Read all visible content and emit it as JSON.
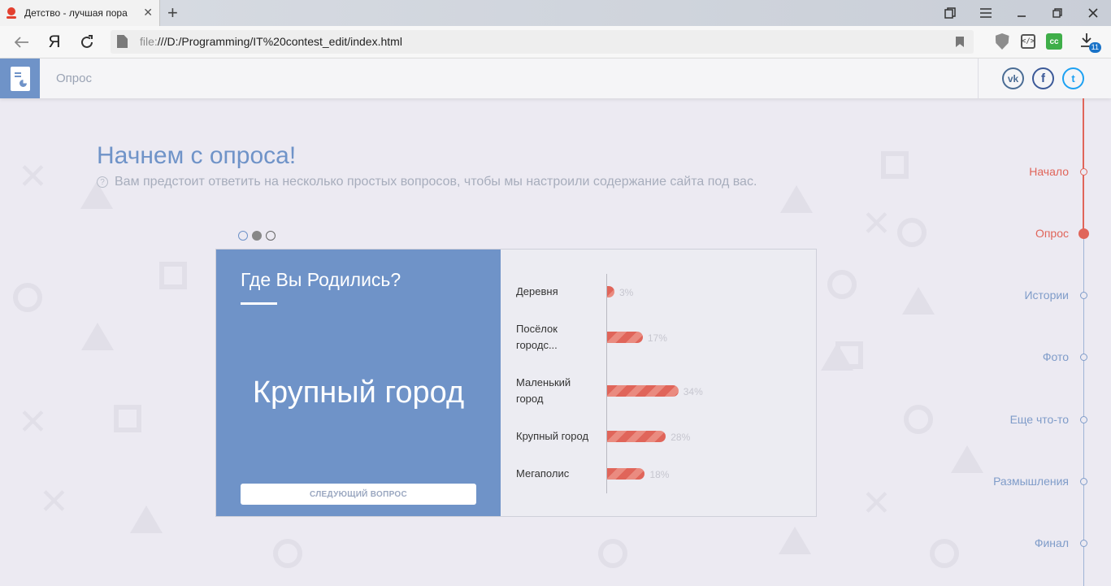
{
  "browser": {
    "tab_title": "Детство - лучшая пора",
    "tab_close": "✕",
    "new_tab": "+",
    "url_protocol": "file:",
    "url_rest": "///D:/Programming/IT%20contest_edit/index.html",
    "yandex_logo": "Я",
    "download_count": "11",
    "code_ext_label": "</>",
    "cc_ext_label": "cc"
  },
  "site": {
    "nav_label": "Опрос",
    "social": {
      "vk": "vk",
      "fb": "f",
      "tw": "t"
    }
  },
  "intro": {
    "title": "Начнем с опроса!",
    "help": "?",
    "subtitle": "Вам предстоит ответить на несколько простых вопросов, чтобы мы настроили содержание сайта под вас."
  },
  "survey": {
    "question": "Где Вы Родились?",
    "selected_answer": "Крупный город",
    "next_button": "СЛЕДУЮЩИЙ ВОПРОС",
    "slides": {
      "count": 3,
      "active_index": 1
    }
  },
  "chart_data": {
    "type": "bar",
    "orientation": "horizontal",
    "categories": [
      "Деревня",
      "Посёлок городс...",
      "Маленький город",
      "Крупный город",
      "Мегаполис"
    ],
    "category_lines": [
      [
        "Деревня"
      ],
      [
        "Посёлок",
        "городс..."
      ],
      [
        "Маленький",
        "город"
      ],
      [
        "Крупный город"
      ],
      [
        "Мегаполис"
      ]
    ],
    "values": [
      3,
      17,
      34,
      28,
      18
    ],
    "value_labels": [
      "3%",
      "17%",
      "34%",
      "28%",
      "18%"
    ],
    "unit": "%",
    "color": "#e0655a"
  },
  "timeline": {
    "items": [
      {
        "label": "Начало",
        "state": "done"
      },
      {
        "label": "Опрос",
        "state": "current"
      },
      {
        "label": "Истории",
        "state": "todo"
      },
      {
        "label": "Фото",
        "state": "todo"
      },
      {
        "label": "Еще что-то",
        "state": "todo"
      },
      {
        "label": "Размышления",
        "state": "todo"
      },
      {
        "label": "Финал",
        "state": "todo"
      }
    ]
  },
  "colors": {
    "accent_blue": "#6f93c8",
    "accent_red": "#e0655a",
    "background": "#eceaf2"
  }
}
